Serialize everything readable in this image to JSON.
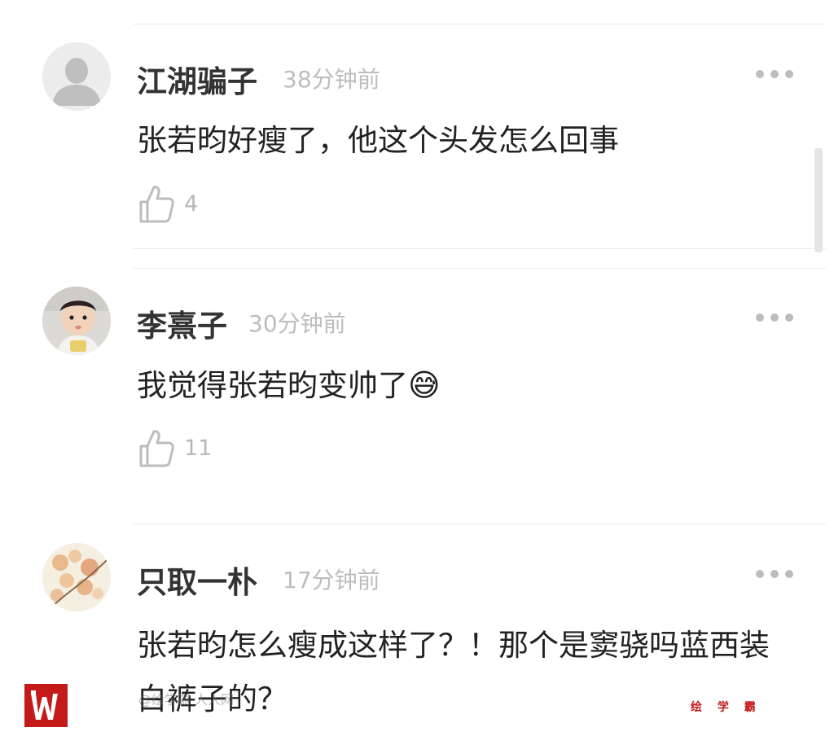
{
  "comments": [
    {
      "username": "江湖骗子",
      "time": "38分钟前",
      "text": "张若昀好瘦了，他这个头发怎么回事",
      "likes": "4",
      "avatar": "default-avatar"
    },
    {
      "username": "李熹子",
      "time": "30分钟前",
      "text": "我觉得张若昀变帅了",
      "emoji": "😅",
      "likes": "11",
      "avatar": "baby-photo-avatar"
    },
    {
      "username": "只取一朴",
      "time": "17分钟前",
      "text": "张若昀怎么瘦成这样了？！那个是窦骁吗蓝西装白裤子的？",
      "avatar": "blossom-photo-avatar"
    }
  ],
  "icons": {
    "more": "more-dots-icon",
    "like": "thumbs-up-icon"
  },
  "watermark": {
    "brand_text": "绘 学 霸",
    "faint_text": "@绘学霸 人人网",
    "color": "#c41a1a"
  },
  "colors": {
    "username": "#333333",
    "text": "#222222",
    "meta": "#bdbdbd",
    "divider": "#e9e9e9"
  }
}
